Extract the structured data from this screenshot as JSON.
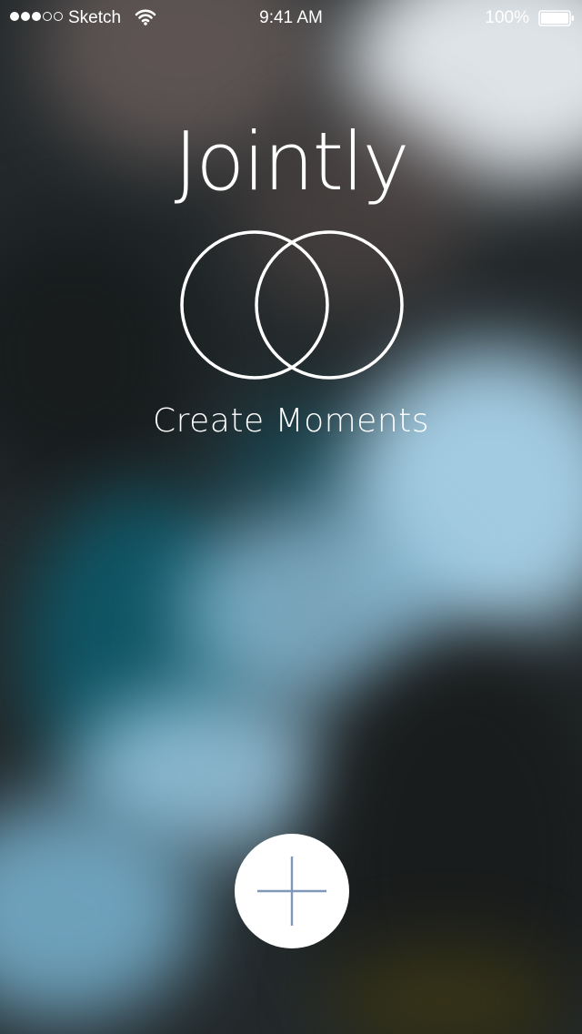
{
  "status_bar": {
    "carrier": "Sketch",
    "time": "9:41 AM",
    "battery_percent": "100%",
    "signal_icon": "signal-dots-icon",
    "wifi_icon": "wifi-icon",
    "battery_icon": "battery-icon"
  },
  "main": {
    "app_title": "Jointly",
    "logo_icon": "overlapping-circles-icon",
    "tagline": "Create Moments",
    "add_button_icon": "plus-icon"
  },
  "colors": {
    "text": "#ffffff",
    "button_background": "#ffffff",
    "plus_stroke": "#7f97b8"
  }
}
